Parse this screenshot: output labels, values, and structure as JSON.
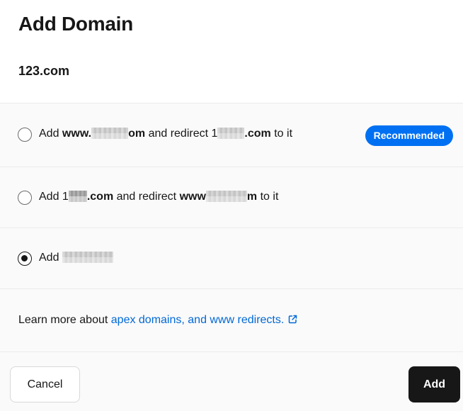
{
  "dialog": {
    "title": "Add Domain",
    "domain": "123.com"
  },
  "options": [
    {
      "id": "www-redirect",
      "selected": false,
      "text": {
        "add": "Add",
        "bold1_prefix": "www.",
        "bold1_suffix": "om",
        "middle": "and redirect",
        "plain2_prefix": "1",
        "bold2_suffix": ".com",
        "end": "to it"
      },
      "badge": "Recommended"
    },
    {
      "id": "apex-redirect",
      "selected": false,
      "text": {
        "add": "Add",
        "plain1_prefix": "1",
        "bold1_suffix": ".com",
        "middle": "and redirect",
        "bold2_prefix": "www",
        "bold2_suffix": "m",
        "end": "to it"
      }
    },
    {
      "id": "apex-only",
      "selected": true,
      "text": {
        "add": "Add"
      }
    }
  ],
  "learn_more": {
    "prefix": "Learn more about",
    "link_text": "apex domains, and www redirects.",
    "icon": "external-link-icon"
  },
  "footer": {
    "cancel_label": "Cancel",
    "add_label": "Add"
  },
  "colors": {
    "accent": "#0070f3",
    "link": "#0068d6",
    "primary_button": "#171717"
  }
}
